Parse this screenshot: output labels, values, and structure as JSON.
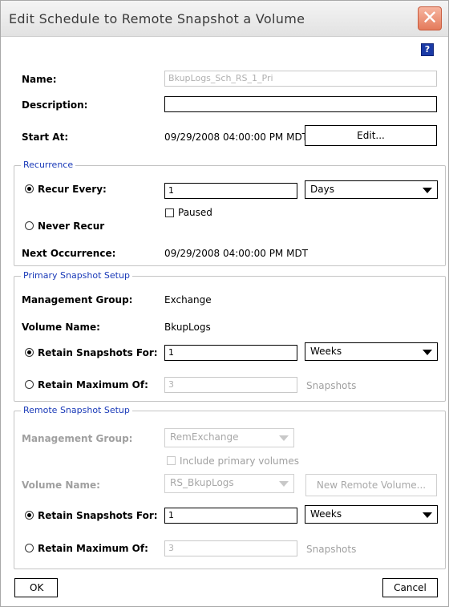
{
  "dialog": {
    "title": "Edit Schedule to Remote Snapshot a Volume",
    "close_icon": "close-icon",
    "help_label": "?"
  },
  "general": {
    "name_label": "Name:",
    "name_value": "BkupLogs_Sch_RS_1_Pri",
    "description_label": "Description:",
    "description_value": "",
    "start_at_label": "Start At:",
    "start_at_value": "09/29/2008 04:00:00 PM MDT",
    "edit_button": "Edit..."
  },
  "recurrence": {
    "legend": "Recurrence",
    "recur_every_label": "Recur Every:",
    "recur_every_value": "1",
    "recur_unit": "Days",
    "paused_label": "Paused",
    "never_recur_label": "Never Recur",
    "next_occurrence_label": "Next Occurrence:",
    "next_occurrence_value": "09/29/2008 04:00:00 PM MDT"
  },
  "primary": {
    "legend": "Primary Snapshot Setup",
    "mgmt_group_label": "Management Group:",
    "mgmt_group_value": "Exchange",
    "volume_name_label": "Volume Name:",
    "volume_name_value": "BkupLogs",
    "retain_for_label": "Retain Snapshots For:",
    "retain_for_value": "1",
    "retain_for_unit": "Weeks",
    "retain_max_label": "Retain Maximum Of:",
    "retain_max_value": "3",
    "retain_max_unit": "Snapshots"
  },
  "remote": {
    "legend": "Remote Snapshot Setup",
    "mgmt_group_label": "Management Group:",
    "mgmt_group_value": "RemExchange",
    "include_primary_label": "Include primary volumes",
    "volume_name_label": "Volume Name:",
    "volume_name_value": "RS_BkupLogs",
    "new_remote_volume_button": "New Remote Volume...",
    "retain_for_label": "Retain Snapshots For:",
    "retain_for_value": "1",
    "retain_for_unit": "Weeks",
    "retain_max_label": "Retain Maximum Of:",
    "retain_max_value": "3",
    "retain_max_unit": "Snapshots"
  },
  "footer": {
    "ok_button": "OK",
    "cancel_button": "Cancel"
  }
}
